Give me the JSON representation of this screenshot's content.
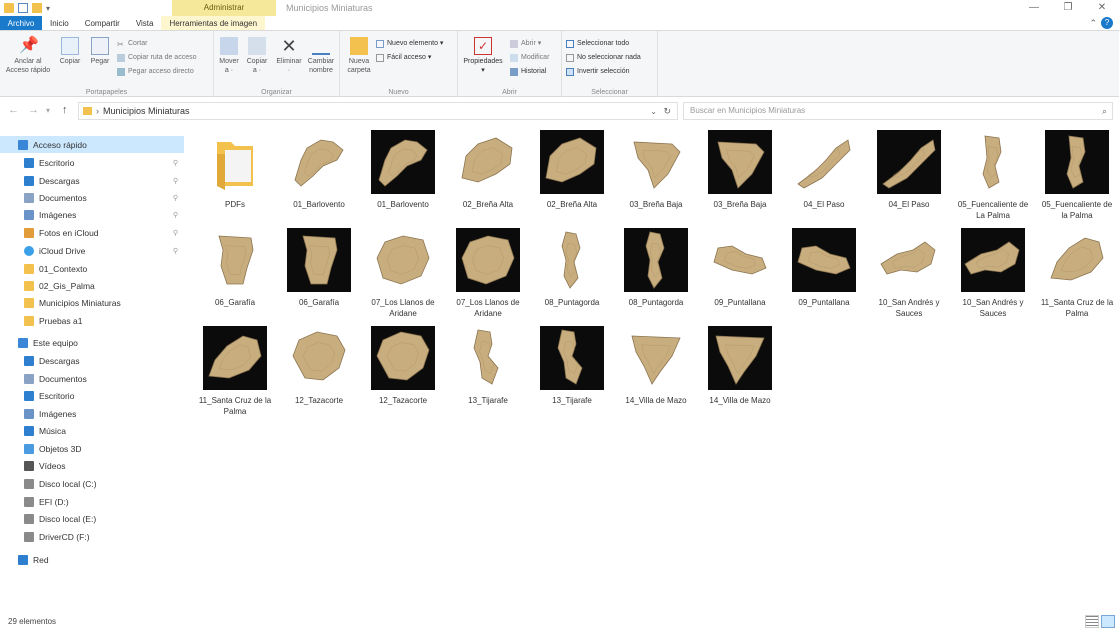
{
  "window": {
    "title": "Municipios Miniaturas",
    "context_tab_header": "Administrar",
    "controls": [
      "—",
      "❐",
      "✕"
    ]
  },
  "ribbon_tabs": {
    "file": "Archivo",
    "home": "Inicio",
    "share": "Compartir",
    "view": "Vista",
    "image_tools": "Herramientas de imagen"
  },
  "ribbon": {
    "portapapeles": {
      "name": "Portapapeles",
      "pin": "Anclar al\nAcceso rápido",
      "copy": "Copiar",
      "paste": "Pegar",
      "cut": "Cortar",
      "copy_path": "Copiar ruta de acceso",
      "paste_shortcut": "Pegar acceso directo"
    },
    "organizar": {
      "name": "Organizar",
      "move": "Mover\na ·",
      "copy_to": "Copiar\na ·",
      "delete": "Eliminar\n·",
      "rename": "Cambiar\nnombre"
    },
    "nuevo": {
      "name": "Nuevo",
      "new_folder": "Nueva\ncarpeta",
      "new_item": "Nuevo elemento ▾",
      "easy_access": "Fácil acceso ▾"
    },
    "abrir": {
      "name": "Abrir",
      "properties": "Propiedades\n▾",
      "open": "Abrir ▾",
      "edit": "Modificar",
      "history": "Historial"
    },
    "seleccionar": {
      "name": "Seleccionar",
      "select_all": "Seleccionar todo",
      "select_none": "No seleccionar nada",
      "invert": "Invertir selección"
    }
  },
  "address": {
    "path": "Municipios Miniaturas",
    "search_placeholder": "Buscar en Municipios Miniaturas"
  },
  "nav": {
    "items": [
      {
        "label": "Acceso rápido",
        "icon": "star-icon",
        "pin": false
      },
      {
        "label": "Escritorio",
        "icon": "desktop-icon",
        "pin": true
      },
      {
        "label": "Descargas",
        "icon": "download-icon",
        "pin": true
      },
      {
        "label": "Documentos",
        "icon": "documents-icon",
        "pin": true
      },
      {
        "label": "Imágenes",
        "icon": "pictures-icon",
        "pin": true
      },
      {
        "label": "Fotos en iCloud",
        "icon": "icloud-photos-icon",
        "pin": true
      },
      {
        "label": "iCloud Drive",
        "icon": "icloud-drive-icon",
        "pin": true
      },
      {
        "label": "01_Contexto",
        "icon": "folder-icon",
        "pin": false
      },
      {
        "label": "02_Gis_Palma",
        "icon": "folder-icon",
        "pin": false
      },
      {
        "label": "Municipios Miniaturas",
        "icon": "folder-icon",
        "pin": false
      },
      {
        "label": "Pruebas a1",
        "icon": "folder-icon",
        "pin": false
      },
      {
        "label": "Este equipo",
        "icon": "pc-icon",
        "pin": false
      },
      {
        "label": "Descargas",
        "icon": "download-icon",
        "pin": false
      },
      {
        "label": "Documentos",
        "icon": "documents-icon",
        "pin": false
      },
      {
        "label": "Escritorio",
        "icon": "desktop-icon",
        "pin": false
      },
      {
        "label": "Imágenes",
        "icon": "pictures-icon",
        "pin": false
      },
      {
        "label": "Música",
        "icon": "music-icon",
        "pin": false
      },
      {
        "label": "Objetos 3D",
        "icon": "3d-objects-icon",
        "pin": false
      },
      {
        "label": "Vídeos",
        "icon": "videos-icon",
        "pin": false
      },
      {
        "label": "Disco local (C:)",
        "icon": "drive-icon",
        "pin": false
      },
      {
        "label": "EFI (D:)",
        "icon": "drive-icon",
        "pin": false
      },
      {
        "label": "Disco local (E:)",
        "icon": "drive-icon",
        "pin": false
      },
      {
        "label": "DriverCD (F:)",
        "icon": "drive-icon",
        "pin": false
      },
      {
        "label": "Red",
        "icon": "network-icon",
        "pin": false
      }
    ]
  },
  "files": [
    {
      "label": "PDFs",
      "kind": "folder",
      "dark": false
    },
    {
      "label": "01_Barlovento",
      "kind": "image",
      "dark": false
    },
    {
      "label": "01_Barlovento",
      "kind": "image",
      "dark": true
    },
    {
      "label": "02_Breña Alta",
      "kind": "image",
      "dark": false
    },
    {
      "label": "02_Breña Alta",
      "kind": "image",
      "dark": true
    },
    {
      "label": "03_Breña Baja",
      "kind": "image",
      "dark": false
    },
    {
      "label": "03_Breña Baja",
      "kind": "image",
      "dark": true
    },
    {
      "label": "04_El Paso",
      "kind": "image",
      "dark": false
    },
    {
      "label": "04_El Paso",
      "kind": "image",
      "dark": true
    },
    {
      "label": "05_Fuencaliente de La Palma",
      "kind": "image",
      "dark": false
    },
    {
      "label": "05_Fuencaliente de la Palma",
      "kind": "image",
      "dark": true
    },
    {
      "label": "06_Garafía",
      "kind": "image",
      "dark": false
    },
    {
      "label": "06_Garafía",
      "kind": "image",
      "dark": true
    },
    {
      "label": "07_Los Llanos de Aridane",
      "kind": "image",
      "dark": false
    },
    {
      "label": "07_Los Llanos de Aridane",
      "kind": "image",
      "dark": true
    },
    {
      "label": "08_Puntagorda",
      "kind": "image",
      "dark": false
    },
    {
      "label": "08_Puntagorda",
      "kind": "image",
      "dark": true
    },
    {
      "label": "09_Puntallana",
      "kind": "image",
      "dark": false
    },
    {
      "label": "09_Puntallana",
      "kind": "image",
      "dark": true
    },
    {
      "label": "10_San Andrés y Sauces",
      "kind": "image",
      "dark": false
    },
    {
      "label": "10_San Andrés y Sauces",
      "kind": "image",
      "dark": true
    },
    {
      "label": "11_Santa Cruz de la Palma",
      "kind": "image",
      "dark": false
    },
    {
      "label": "11_Santa Cruz de la Palma",
      "kind": "image",
      "dark": true
    },
    {
      "label": "12_Tazacorte",
      "kind": "image",
      "dark": false
    },
    {
      "label": "12_Tazacorte",
      "kind": "image",
      "dark": true
    },
    {
      "label": "13_Tijarafe",
      "kind": "image",
      "dark": false
    },
    {
      "label": "13_Tijarafe",
      "kind": "image",
      "dark": true
    },
    {
      "label": "14_Villa de Mazo",
      "kind": "image",
      "dark": false
    },
    {
      "label": "14_Villa de Mazo",
      "kind": "image",
      "dark": true
    }
  ],
  "status": {
    "count": "29 elementos"
  },
  "colors": {
    "accent": "#1979ca",
    "selection": "#cce8ff",
    "context_tab": "#f6e89a",
    "folder": "#f2c14e",
    "terrain": "#c8ad7f"
  }
}
